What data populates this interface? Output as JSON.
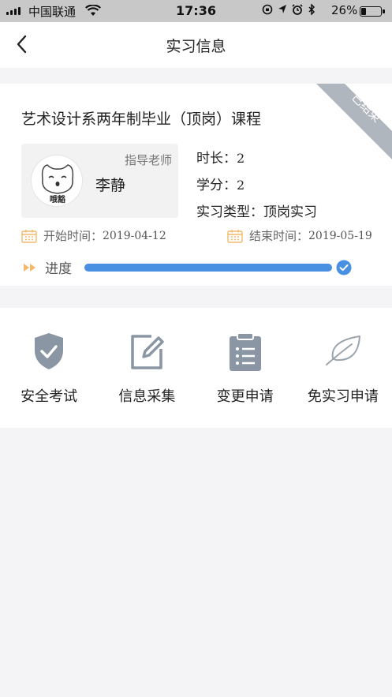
{
  "status_bar": {
    "carrier": "中国联通",
    "time": "17:36",
    "battery": "26%",
    "battery_level": 0.26,
    "icons": [
      "orientation-lock-icon",
      "location-icon",
      "alarm-icon",
      "bluetooth-icon"
    ]
  },
  "header": {
    "title": "实习信息",
    "back_icon": "chevron-left-icon"
  },
  "course": {
    "title": "艺术设计系两年制毕业（顶岗）课程",
    "status_badge": "已结束",
    "teacher": {
      "role": "指导老师",
      "name": "李静",
      "avatar_caption": "哦豁"
    },
    "duration_label": "时长：",
    "duration_value": "2",
    "credit_label": "学分：",
    "credit_value": "2",
    "type_label": "实习类型：",
    "type_value": "顶岗实习",
    "start_label": "开始时间：",
    "start_value": "2019-04-12",
    "end_label": "结束时间：",
    "end_value": "2019-05-19",
    "progress_label": "进度",
    "progress": 1.0
  },
  "actions": [
    {
      "label": "安全考试",
      "icon": "shield-check-icon"
    },
    {
      "label": "信息采集",
      "icon": "edit-icon"
    },
    {
      "label": "变更申请",
      "icon": "clipboard-icon"
    },
    {
      "label": "免实习申请",
      "icon": "leaf-icon"
    }
  ],
  "colors": {
    "accent": "#4a90e2",
    "icon_gray": "#8a96a3",
    "calendar_orange": "#f3b86b",
    "badge_gray": "#b0b6bd"
  }
}
